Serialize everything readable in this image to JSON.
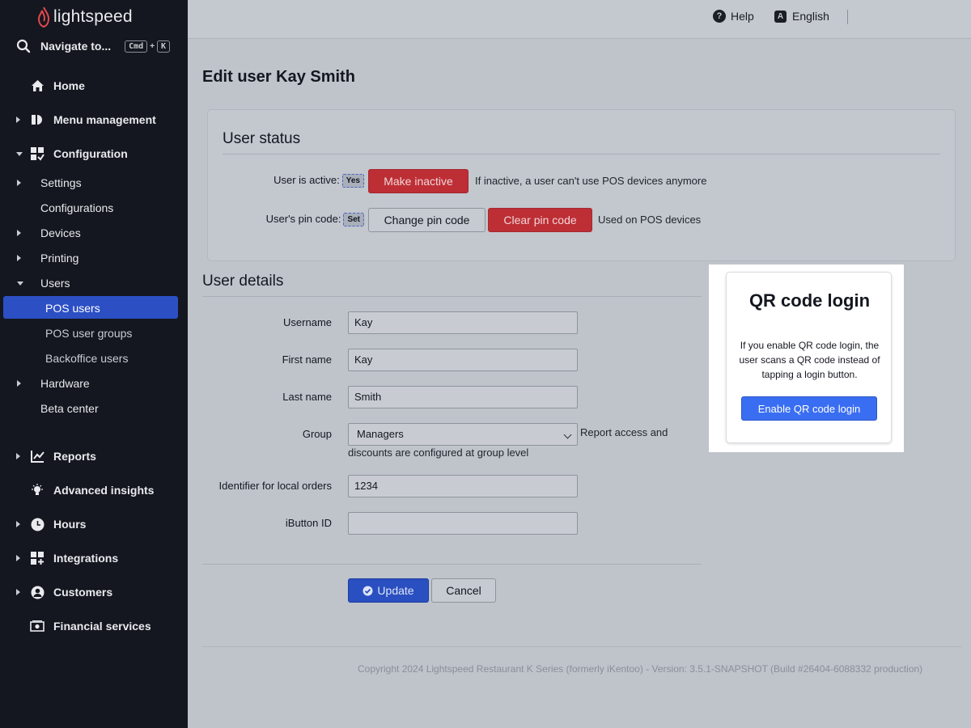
{
  "app": {
    "brand": "lightspeed"
  },
  "sidebar": {
    "search_label": "Navigate to...",
    "shortcut_key1": "Cmd",
    "shortcut_plus": "+",
    "shortcut_key2": "K",
    "items": [
      {
        "label": "Home",
        "icon": "home-icon"
      },
      {
        "label": "Menu management",
        "icon": "menu-management-icon"
      },
      {
        "label": "Configuration",
        "icon": "configuration-icon"
      },
      {
        "label": "Settings"
      },
      {
        "label": "Configurations"
      },
      {
        "label": "Devices"
      },
      {
        "label": "Printing"
      },
      {
        "label": "Users"
      },
      {
        "label": "POS users"
      },
      {
        "label": "POS user groups"
      },
      {
        "label": "Backoffice users"
      },
      {
        "label": "Hardware"
      },
      {
        "label": "Beta center"
      },
      {
        "label": "Reports",
        "icon": "reports-icon"
      },
      {
        "label": "Advanced insights",
        "icon": "lightbulb-icon"
      },
      {
        "label": "Hours",
        "icon": "clock-icon"
      },
      {
        "label": "Integrations",
        "icon": "integrations-icon"
      },
      {
        "label": "Customers",
        "icon": "customer-icon"
      },
      {
        "label": "Financial services",
        "icon": "cash-icon"
      }
    ]
  },
  "topbar": {
    "help": "Help",
    "language_icon_letter": "A",
    "language": "English"
  },
  "page": {
    "title": "Edit user Kay Smith"
  },
  "user_status": {
    "title": "User status",
    "active_label": "User is active:",
    "active_value": "Yes",
    "make_inactive": "Make inactive",
    "inactive_hint": "If inactive, a user can't use POS devices anymore",
    "pin_label": "User's pin code:",
    "pin_value": "Set",
    "change_pin": "Change pin code",
    "clear_pin": "Clear pin code",
    "pin_hint": "Used on POS devices"
  },
  "user_details": {
    "title": "User details",
    "username_label": "Username",
    "username_value": "Kay",
    "firstname_label": "First name",
    "firstname_value": "Kay",
    "lastname_label": "Last name",
    "lastname_value": "Smith",
    "group_label": "Group",
    "group_value": "Managers",
    "group_hint_1": "Report access and",
    "group_hint_2": "discounts are configured at group level",
    "identifier_label": "Identifier for local orders",
    "identifier_value": "1234",
    "ibutton_label": "iButton ID",
    "ibutton_value": "",
    "update": "Update",
    "cancel": "Cancel"
  },
  "qr_popover": {
    "title": "QR code login",
    "text": "If you enable QR code login, the user scans a QR code instead of tapping a login button.",
    "button": "Enable QR code login"
  },
  "footer": {
    "copyright": "Copyright 2024 Lightspeed Restaurant K Series (formerly iKentoo) - Version: 3.5.1-SNAPSHOT (Build #26404-6088332 production)"
  },
  "colors": {
    "sidebar_bg": "#14171f",
    "active_nav": "#2c4fc4",
    "danger": "#bd2e35",
    "primary": "#2a4fc0",
    "qr_button": "#3a6ef2"
  }
}
